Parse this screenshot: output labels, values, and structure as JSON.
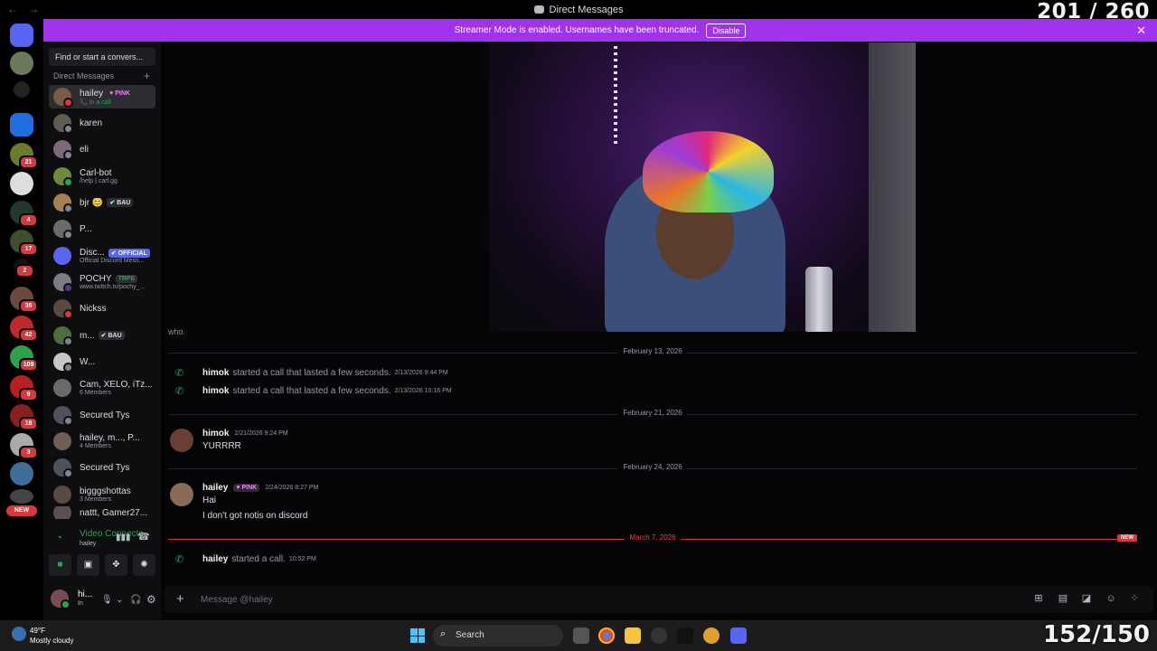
{
  "window": {
    "title": "Direct Messages",
    "nav": "← →",
    "counter_top": "201 / 260",
    "counter_bottom": "152/150"
  },
  "banner": {
    "text": "Streamer Mode is enabled. Usernames have been truncated.",
    "button": "Disable",
    "close": "✕"
  },
  "rail": {
    "badges": [
      "21",
      "4",
      "17",
      "2",
      "35",
      "42",
      "109",
      "9",
      "18",
      "3"
    ],
    "new_label": "NEW"
  },
  "sidebar": {
    "search_placeholder": "Find or start a convers...",
    "header": "Direct Messages",
    "header_plus": "+",
    "dms": [
      {
        "name": "hailey",
        "tag": "♥ PINK",
        "sub": "📞 In a call"
      },
      {
        "name": "karen",
        "tag": "",
        "sub": ""
      },
      {
        "name": "eli",
        "tag": "",
        "sub": ""
      },
      {
        "name": "Carl-bot",
        "tag": "",
        "sub": "/help | carl.gg"
      },
      {
        "name": "bjr 😊",
        "tag": "✔ BAU",
        "sub": ""
      },
      {
        "name": "P...",
        "tag": "",
        "sub": ""
      },
      {
        "name": "Disc...",
        "tag": "✔ OFFICIAL",
        "sub": "Official Discord Mess..."
      },
      {
        "name": "POCHY",
        "tag": "TRPE",
        "sub": "www.twitch.tv/pochy_..."
      },
      {
        "name": "Nickss",
        "tag": "",
        "sub": ""
      },
      {
        "name": "m...",
        "tag": "✔ BAU",
        "sub": ""
      },
      {
        "name": "W...",
        "tag": "",
        "sub": ""
      },
      {
        "name": "Cam, XELO, iTz...",
        "tag": "",
        "sub": "6 Members"
      },
      {
        "name": "Secured Tys",
        "tag": "",
        "sub": ""
      },
      {
        "name": "hailey, m..., P...",
        "tag": "",
        "sub": "4 Members"
      },
      {
        "name": "Secured Tys",
        "tag": "",
        "sub": ""
      },
      {
        "name": "bigggshottas",
        "tag": "",
        "sub": "3 Members"
      },
      {
        "name": "nattt, Gamer27...",
        "tag": "",
        "sub": ""
      }
    ],
    "voice": {
      "title": "Video Connected",
      "sub": "hailey"
    },
    "user": {
      "name": "hi...",
      "status": "In"
    }
  },
  "chat": {
    "cut_text": "who.",
    "dividers": {
      "d1": "February 13, 2026",
      "d2": "February 21, 2026",
      "d3": "February 24, 2026",
      "d4": "March 7, 2026",
      "new_tag": "NEW"
    },
    "calls": [
      {
        "who": "himok",
        "text": "started a call that lasted a few seconds.",
        "ts": "2/13/2026 9:44 PM"
      },
      {
        "who": "himok",
        "text": "started a call that lasted a few seconds.",
        "ts": "2/13/2026 10:16 PM"
      },
      {
        "who": "hailey",
        "text": "started a call.",
        "ts": "10:52 PM"
      }
    ],
    "msg1": {
      "name": "himok",
      "ts": "2/21/2026 9:24 PM",
      "lines": [
        "YURRRR"
      ]
    },
    "msg2": {
      "name": "hailey",
      "tag": "♥ PINK",
      "ts": "2/24/2026 8:27 PM",
      "lines": [
        "Hai",
        "I don't got notis on discord"
      ]
    },
    "composer_placeholder": "Message @hailey"
  },
  "taskbar": {
    "temp": "49°F",
    "condition": "Mostly cloudy",
    "search": "Search"
  },
  "colors": {
    "accent": "#5865f2",
    "banner": "#a133ef",
    "online": "#23a55a",
    "danger": "#da373c"
  }
}
